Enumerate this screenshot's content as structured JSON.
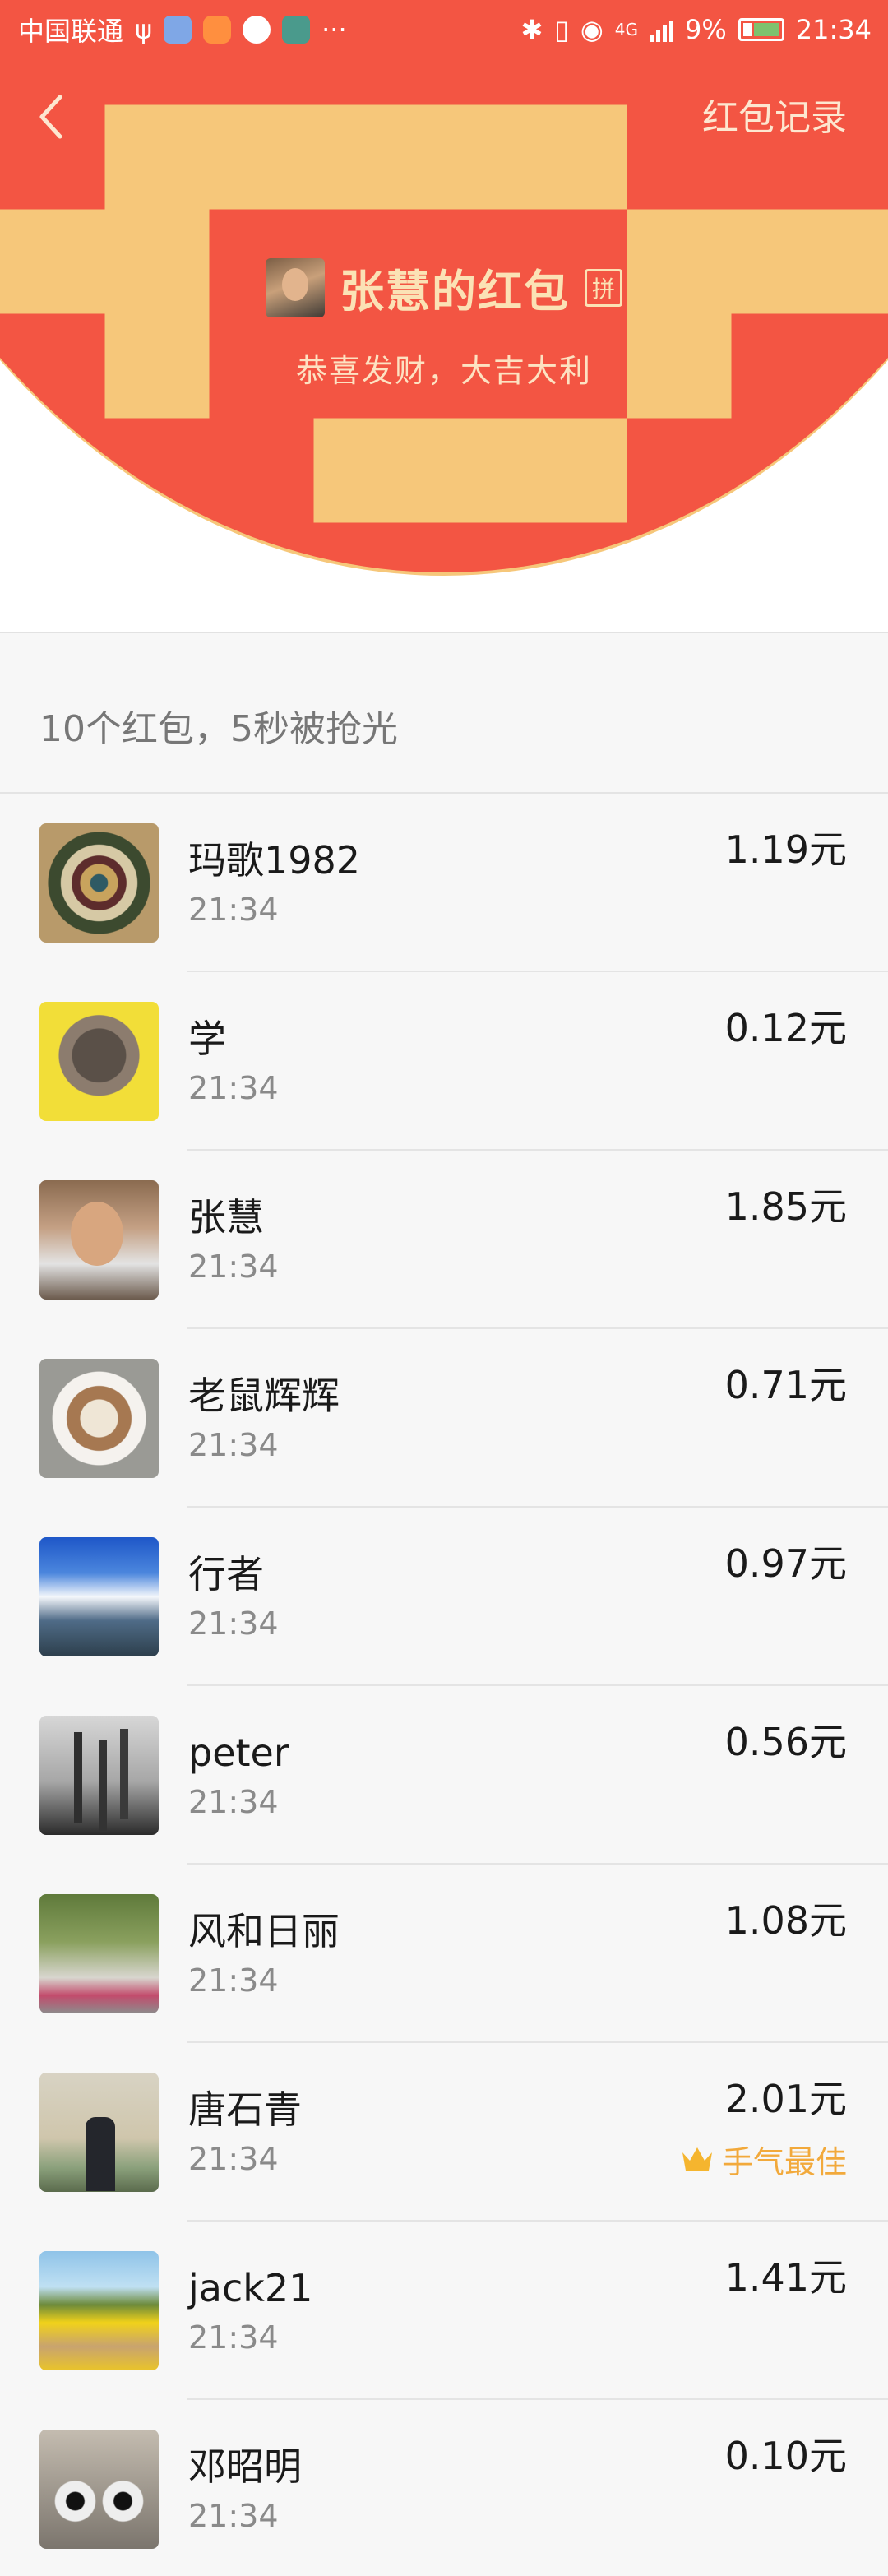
{
  "status_bar": {
    "carrier": "中国联通",
    "network": "4G",
    "battery": "9%",
    "time": "21:34"
  },
  "header": {
    "back_icon": "chevron-left-icon",
    "record_label": "红包记录",
    "sender_name": "张慧的红包",
    "pin_badge": "拼",
    "wish": "恭喜发财，大吉大利"
  },
  "summary": "10个红包，5秒被抢光",
  "recipients": [
    {
      "name": "玛歌1982",
      "time": "21:34",
      "amount": "1.19元"
    },
    {
      "name": "学",
      "time": "21:34",
      "amount": "0.12元"
    },
    {
      "name": "张慧",
      "time": "21:34",
      "amount": "1.85元"
    },
    {
      "name": "老鼠辉辉",
      "time": "21:34",
      "amount": "0.71元"
    },
    {
      "name": "行者",
      "time": "21:34",
      "amount": "0.97元"
    },
    {
      "name": "peter",
      "time": "21:34",
      "amount": "0.56元"
    },
    {
      "name": "风和日丽",
      "time": "21:34",
      "amount": "1.08元"
    },
    {
      "name": "唐石青",
      "time": "21:34",
      "amount": "2.01元",
      "best": "手气最佳"
    },
    {
      "name": "jack21",
      "time": "21:34",
      "amount": "1.41元"
    },
    {
      "name": "邓昭明",
      "time": "21:34",
      "amount": "0.10元"
    }
  ],
  "colors": {
    "header_red": "#f35543",
    "gold_text": "#fbe2b5",
    "best_orange": "#f2a93b"
  }
}
